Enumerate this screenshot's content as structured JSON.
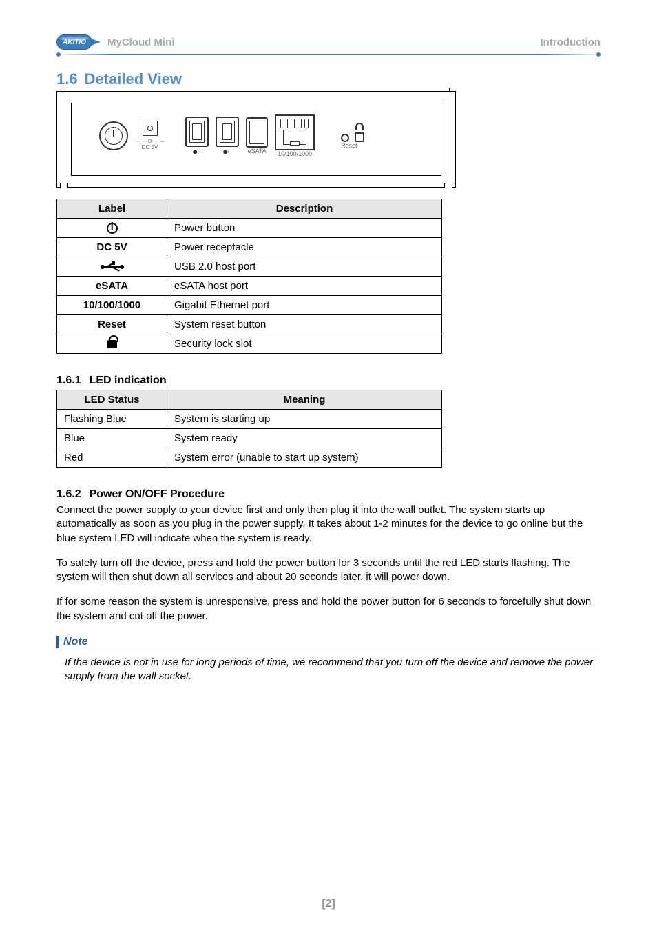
{
  "header": {
    "logo_text": "AKITIO",
    "product_name": "MyCloud Mini",
    "right_label": "Introduction"
  },
  "section": {
    "number": "1.6",
    "title": "Detailed View"
  },
  "diagram_labels": {
    "dc_top": "— —⊖— →",
    "dc": "DC 5V",
    "esata": "eSATA",
    "eth": "10/100/1000",
    "reset": "Reset"
  },
  "table1": {
    "head_label": "Label",
    "head_desc": "Description",
    "rows": [
      {
        "label_type": "power",
        "label": "",
        "desc": "Power button"
      },
      {
        "label_type": "text",
        "label": "DC 5V",
        "desc": "Power receptacle"
      },
      {
        "label_type": "usb",
        "label": "",
        "desc": "USB 2.0 host port"
      },
      {
        "label_type": "text",
        "label": "eSATA",
        "desc": "eSATA host port"
      },
      {
        "label_type": "text",
        "label": "10/100/1000",
        "desc": "Gigabit Ethernet port"
      },
      {
        "label_type": "text",
        "label": "Reset",
        "desc": "System reset button"
      },
      {
        "label_type": "lock",
        "label": "",
        "desc": "Security lock slot"
      }
    ]
  },
  "sub1": {
    "number": "1.6.1",
    "title": "LED indication",
    "head_status": "LED Status",
    "head_meaning": "Meaning",
    "rows": [
      {
        "status": "Flashing Blue",
        "meaning": "System is starting up"
      },
      {
        "status": "Blue",
        "meaning": "System ready"
      },
      {
        "status": "Red",
        "meaning": "System error (unable to start up system)"
      }
    ]
  },
  "sub2": {
    "number": "1.6.2",
    "title": "Power ON/OFF Procedure",
    "p1": "Connect the power supply to your device first and only then plug it into the wall outlet. The system starts up automatically as soon as you plug in the power supply. It takes about 1-2 minutes for the device to go online but the blue system LED will indicate when the system is ready.",
    "p2": "To safely turn off the device, press and hold the power button for 3 seconds until the red LED starts flashing. The system will then shut down all services and about 20 seconds later, it will power down.",
    "p3": "If for some reason the system is unresponsive, press and hold the power button for 6 seconds to forcefully shut down the system and cut off the power."
  },
  "note": {
    "label": "Note",
    "text": "If the device is not in use for long periods of time, we recommend that you turn off the device and remove the power supply from the wall socket."
  },
  "footer": {
    "page": "[2]"
  }
}
